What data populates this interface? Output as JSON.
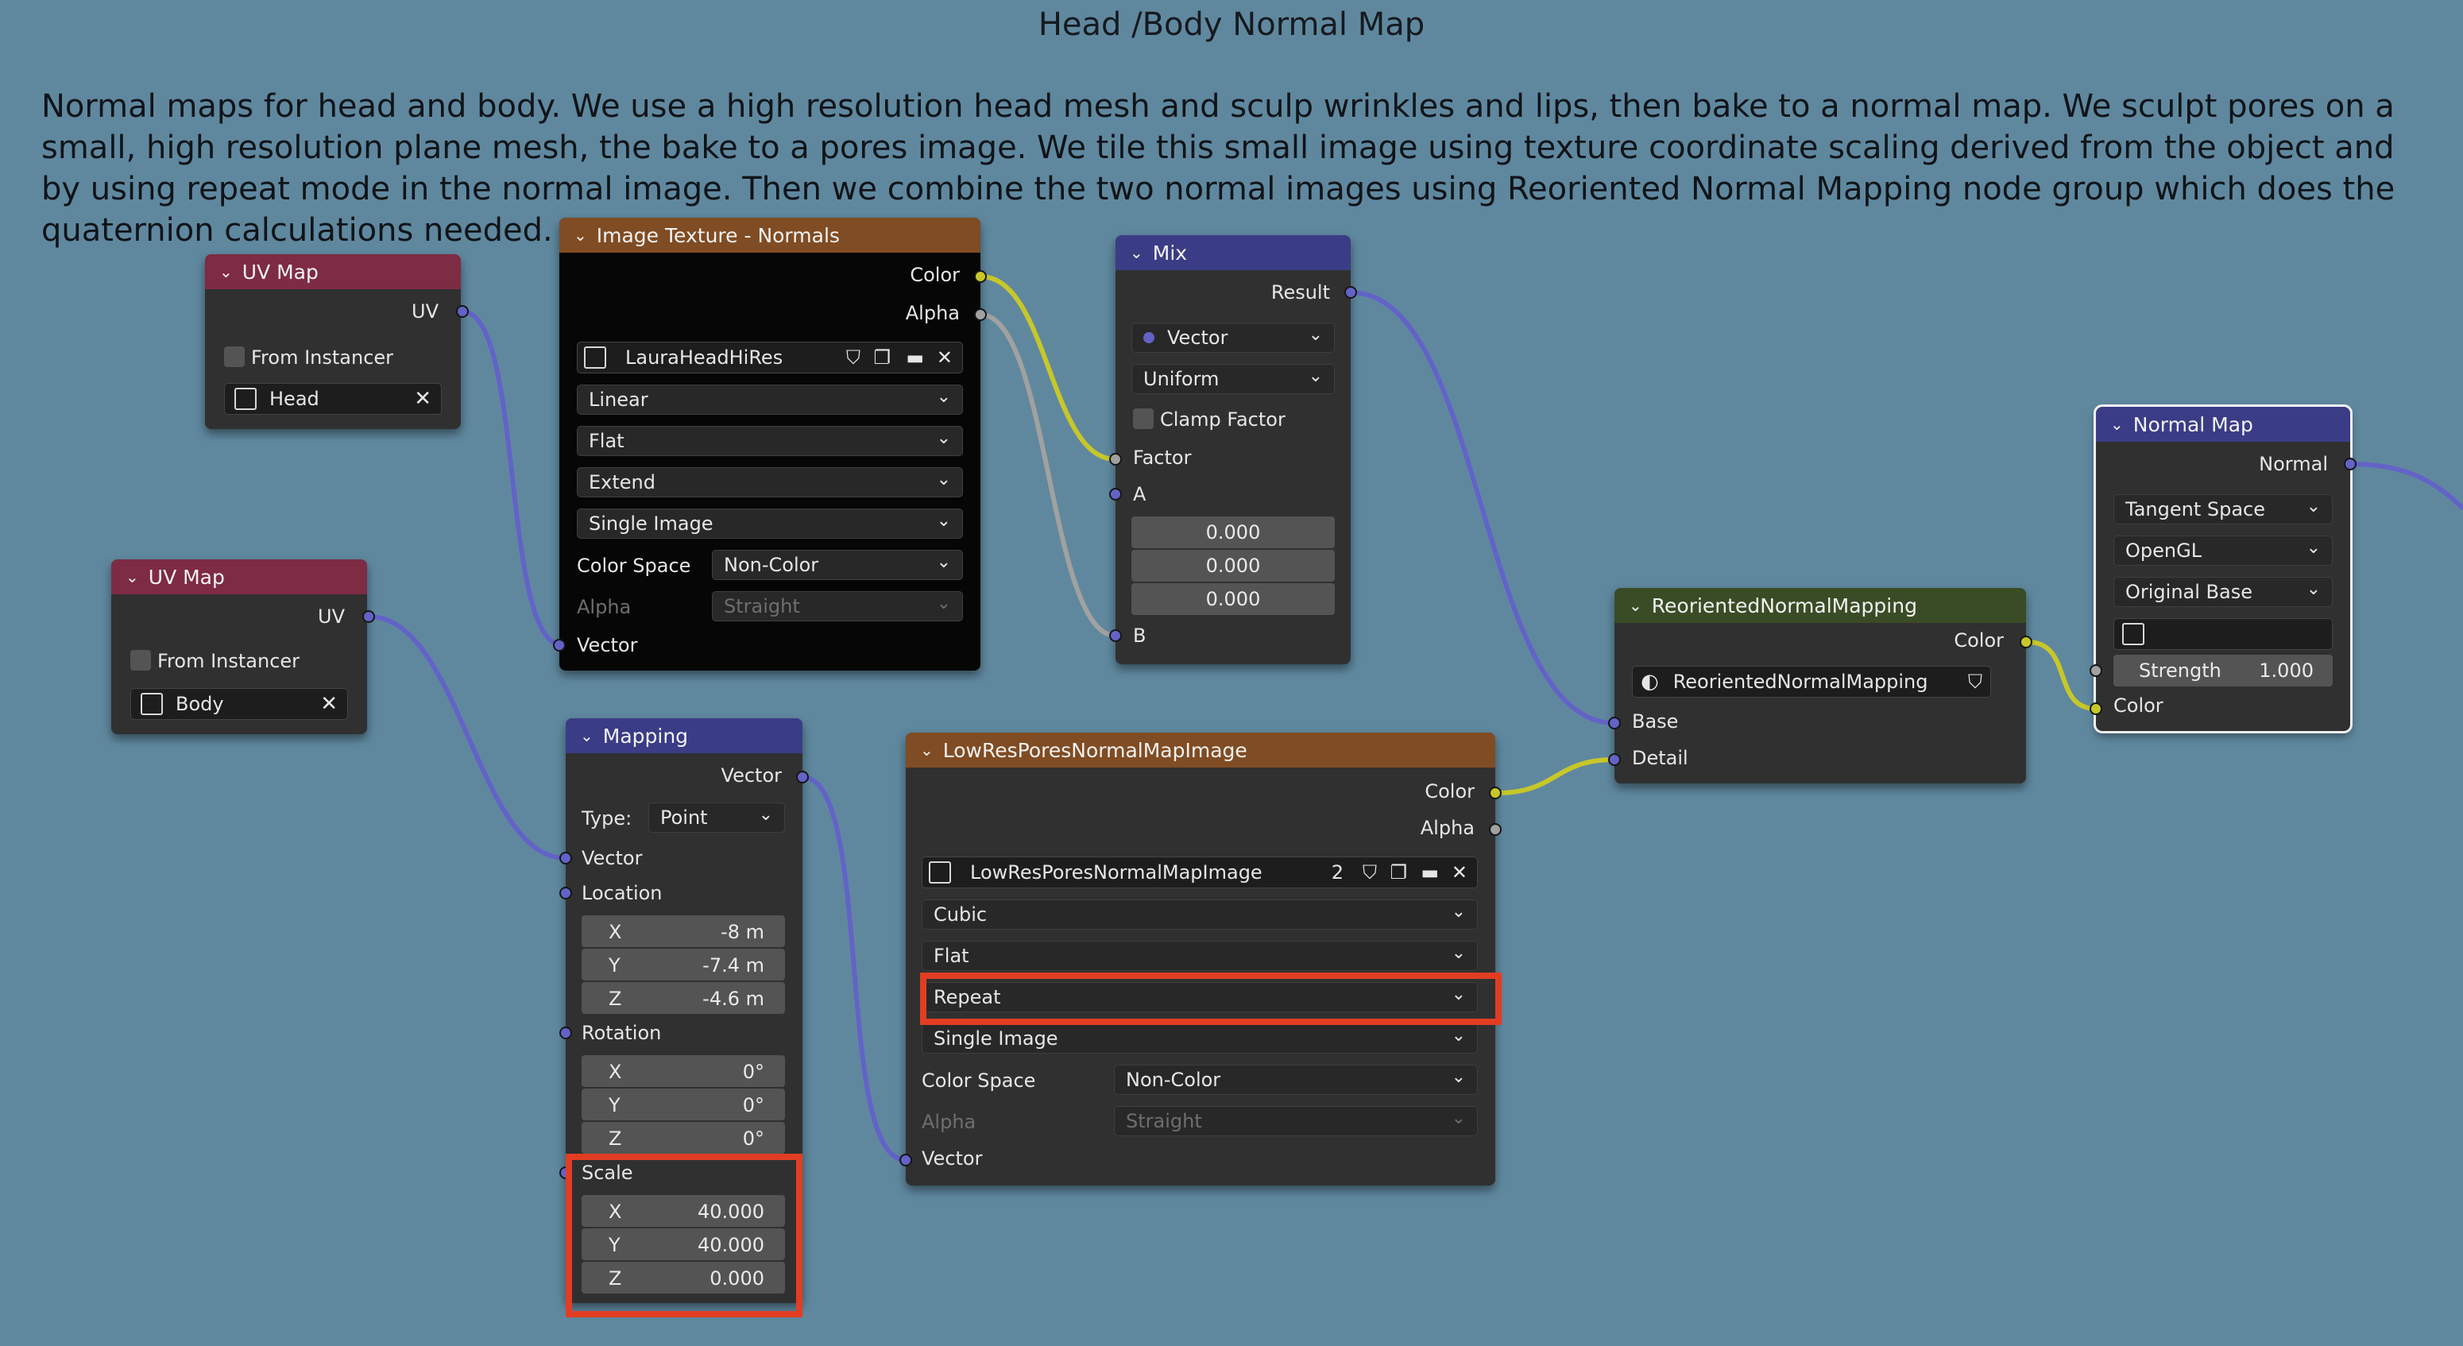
{
  "frame": {
    "title": "Head /Body Normal Map",
    "description": "Normal maps for head and body.  We use a high resolution head mesh and sculp wrinkles and lips, then bake to a normal map.  We sculpt pores on a small, high resolution plane mesh, the bake to a pores image.  We tile this small image using texture coordinate scaling derived from the object and by using repeat mode in the normal image.  Then we combine the two normal images using Reoriented Normal Mapping node group which does the quaternion calculations needed."
  },
  "colors": {
    "background": "#5f889f",
    "uv_header": "#7e2b44",
    "texture_header": "#804c23",
    "vector_header": "#3b3c86",
    "group_header": "#3a4c25",
    "highlight": "#e23d22"
  },
  "uv_head": {
    "title": "UV Map",
    "out_uv": "UV",
    "from_instancer": "From Instancer",
    "map_name": "Head"
  },
  "uv_body": {
    "title": "UV Map",
    "out_uv": "UV",
    "from_instancer": "From Instancer",
    "map_name": "Body"
  },
  "tex_normals": {
    "title": "Image Texture - Normals",
    "out_color": "Color",
    "out_alpha": "Alpha",
    "image": "LauraHeadHiRes",
    "interpolation": "Linear",
    "projection": "Flat",
    "extension": "Extend",
    "source": "Single Image",
    "color_space_label": "Color Space",
    "color_space": "Non-Color",
    "alpha_label": "Alpha",
    "alpha": "Straight",
    "in_vector": "Vector"
  },
  "mix": {
    "title": "Mix",
    "out_result": "Result",
    "data_type": "Vector",
    "factor_mode": "Uniform",
    "clamp_factor": "Clamp Factor",
    "in_factor": "Factor",
    "in_a": "A",
    "a_values": [
      "0.000",
      "0.000",
      "0.000"
    ],
    "in_b": "B"
  },
  "mapping": {
    "title": "Mapping",
    "out_vector": "Vector",
    "type_label": "Type:",
    "type": "Point",
    "in_vector": "Vector",
    "location_label": "Location",
    "location": [
      {
        "axis": "X",
        "value": "-8 m"
      },
      {
        "axis": "Y",
        "value": "-7.4 m"
      },
      {
        "axis": "Z",
        "value": "-4.6 m"
      }
    ],
    "rotation_label": "Rotation",
    "rotation": [
      {
        "axis": "X",
        "value": "0°"
      },
      {
        "axis": "Y",
        "value": "0°"
      },
      {
        "axis": "Z",
        "value": "0°"
      }
    ],
    "scale_label": "Scale",
    "scale": [
      {
        "axis": "X",
        "value": "40.000"
      },
      {
        "axis": "Y",
        "value": "40.000"
      },
      {
        "axis": "Z",
        "value": "0.000"
      }
    ]
  },
  "pores": {
    "title": "LowResPoresNormalMapImage",
    "out_color": "Color",
    "out_alpha": "Alpha",
    "image": "LowResPoresNormalMapImage",
    "users": "2",
    "interpolation": "Cubic",
    "projection": "Flat",
    "extension": "Repeat",
    "source": "Single Image",
    "color_space_label": "Color Space",
    "color_space": "Non-Color",
    "alpha_label": "Alpha",
    "alpha": "Straight",
    "in_vector": "Vector"
  },
  "rnm": {
    "title": "ReorientedNormalMapping",
    "out_color": "Color",
    "group_name": "ReorientedNormalMapping",
    "in_base": "Base",
    "in_detail": "Detail"
  },
  "normal_map": {
    "title": "Normal Map",
    "out_normal": "Normal",
    "space": "Tangent Space",
    "convention": "OpenGL",
    "base": "Original Base",
    "strength_label": "Strength",
    "strength": "1.000",
    "in_color": "Color"
  }
}
